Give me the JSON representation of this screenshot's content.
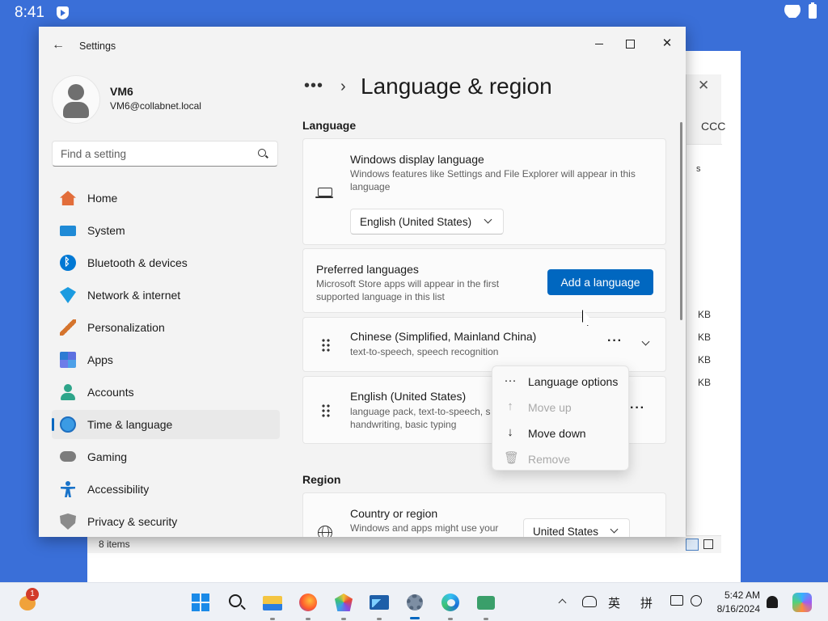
{
  "status_bar": {
    "time": "8:41"
  },
  "settings": {
    "app_title": "Settings",
    "profile": {
      "name": "VM6",
      "email": "VM6@collabnet.local"
    },
    "search_placeholder": "Find a setting",
    "nav": [
      {
        "label": "Home",
        "icon": "home-icon"
      },
      {
        "label": "System",
        "icon": "monitor-icon"
      },
      {
        "label": "Bluetooth & devices",
        "icon": "bluetooth-icon"
      },
      {
        "label": "Network & internet",
        "icon": "wifi-icon"
      },
      {
        "label": "Personalization",
        "icon": "brush-icon"
      },
      {
        "label": "Apps",
        "icon": "apps-icon"
      },
      {
        "label": "Accounts",
        "icon": "person-icon"
      },
      {
        "label": "Time & language",
        "icon": "globe-clock-icon",
        "active": true
      },
      {
        "label": "Gaming",
        "icon": "gamepad-icon"
      },
      {
        "label": "Accessibility",
        "icon": "accessibility-icon"
      },
      {
        "label": "Privacy & security",
        "icon": "shield-icon"
      }
    ],
    "breadcrumb_more": "•••",
    "breadcrumb_sep": "›",
    "page_title": "Language & region",
    "language_section": "Language",
    "display_language": {
      "title": "Windows display language",
      "description": "Windows features like Settings and File Explorer will appear in this language",
      "value": "English (United States)"
    },
    "preferred_languages": {
      "title": "Preferred languages",
      "description": "Microsoft Store apps will appear in the first supported language in this list",
      "add_button": "Add a language"
    },
    "languages": [
      {
        "name": "Chinese (Simplified, Mainland China)",
        "features": "text-to-speech, speech recognition"
      },
      {
        "name": "English (United States)",
        "features": "language pack, text-to-speech, s",
        "features2": "handwriting, basic typing"
      }
    ],
    "region_section": "Region",
    "country": {
      "title": "Country or region",
      "description": "Windows and apps might use your",
      "value": "United States"
    },
    "context_menu": [
      {
        "label": "Language options",
        "icon": "more-icon",
        "enabled": true
      },
      {
        "label": "Move up",
        "icon": "arrow-up-icon",
        "enabled": false
      },
      {
        "label": "Move down",
        "icon": "arrow-down-icon",
        "enabled": true
      },
      {
        "label": "Remove",
        "icon": "trash-icon",
        "enabled": false
      }
    ]
  },
  "explorer": {
    "tab_text": "CCC",
    "col_text": "s",
    "sizes": [
      "KB",
      "KB",
      "KB",
      "KB"
    ],
    "status_items": "8 items"
  },
  "taskbar": {
    "notification_count": "1",
    "ime_mode": "英",
    "ime_pinyin": "拼",
    "clock_time": "5:42 AM",
    "clock_date": "8/16/2024"
  }
}
